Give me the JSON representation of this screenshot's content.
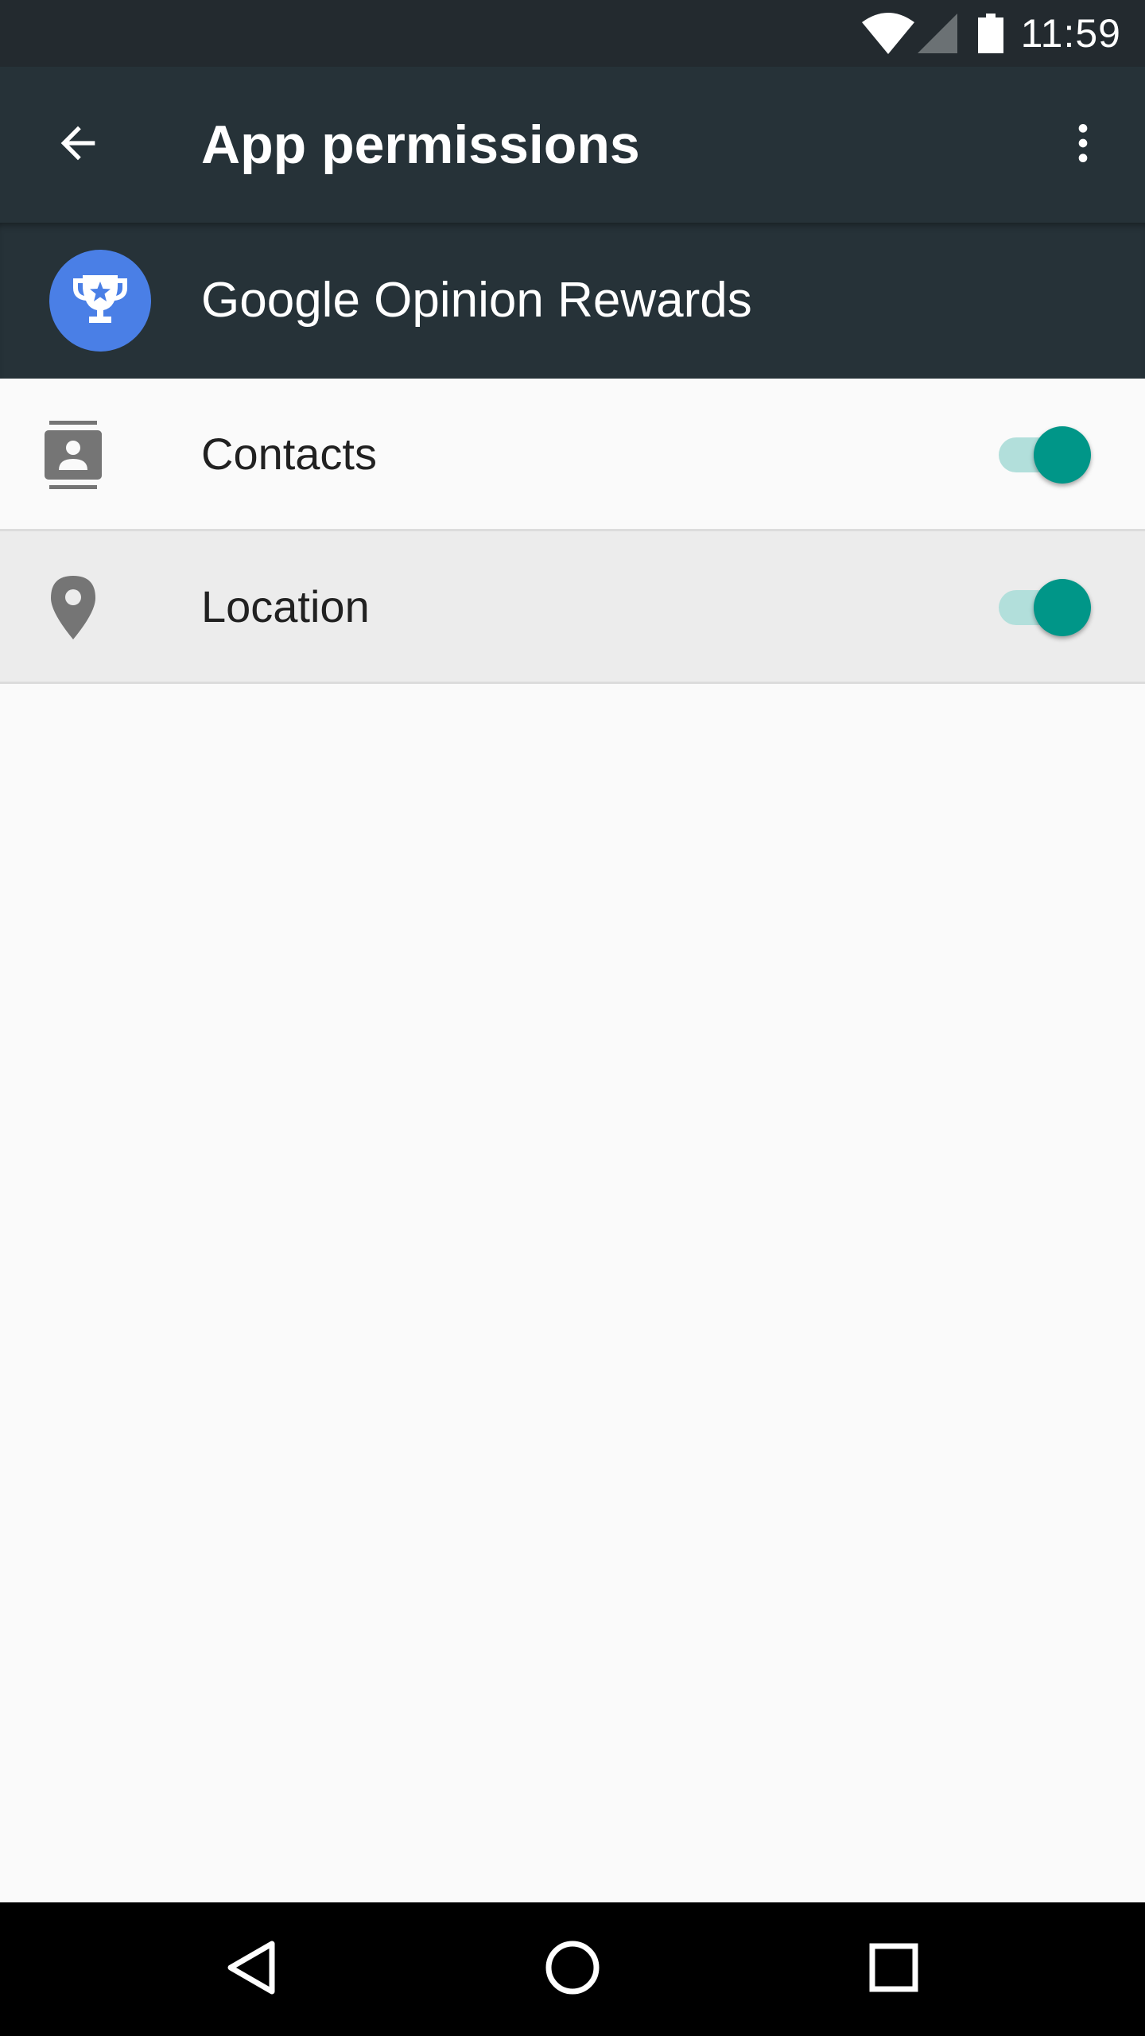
{
  "status_bar": {
    "time": "11:59",
    "icons": [
      "wifi-icon",
      "cellular-signal-icon",
      "battery-icon"
    ]
  },
  "app_bar": {
    "title": "App permissions",
    "back_icon": "arrow-back-icon",
    "more_icon": "more-vert-icon"
  },
  "app_header": {
    "name": "Google Opinion Rewards",
    "icon": "trophy-star-icon",
    "icon_color": "#4a7fe6"
  },
  "permissions": [
    {
      "label": "Contacts",
      "icon": "contacts-icon",
      "enabled": true
    },
    {
      "label": "Location",
      "icon": "location-pin-icon",
      "enabled": true
    }
  ],
  "colors": {
    "status_bar": "#232a2f",
    "app_bar": "#263238",
    "toggle_on_thumb": "#009688",
    "toggle_on_track": "#b2dfdb"
  },
  "nav_bar": {
    "icons": [
      "nav-back-icon",
      "nav-home-icon",
      "nav-recents-icon"
    ]
  }
}
